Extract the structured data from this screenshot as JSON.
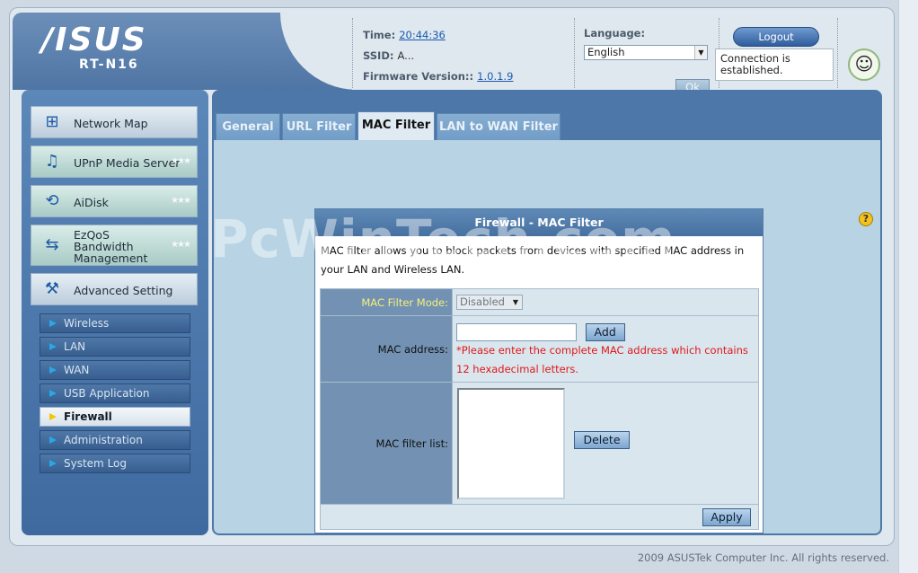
{
  "header": {
    "brand": "/ISUS",
    "model": "RT-N16",
    "time_label": "Time:",
    "time_value": "20:44:36",
    "ssid_label": "SSID:",
    "ssid_value": "A...",
    "firmware_label": "Firmware Version::",
    "firmware_value": "1.0.1.9",
    "language_label": "Language:",
    "language_value": "English",
    "ok_label": "Ok",
    "logout_label": "Logout",
    "connection_status": "Connection is established."
  },
  "sidebar": {
    "items": [
      {
        "label": "Network Map",
        "icon": "network-map-icon"
      },
      {
        "label": "UPnP Media Server",
        "icon": "media-server-icon"
      },
      {
        "label": "AiDisk",
        "icon": "aidisk-icon"
      },
      {
        "label": "EzQoS Bandwidth Management",
        "icon": "ezqos-icon"
      },
      {
        "label": "Advanced Setting",
        "icon": "wrench-icon"
      }
    ],
    "sub_items": [
      {
        "label": "Wireless"
      },
      {
        "label": "LAN"
      },
      {
        "label": "WAN"
      },
      {
        "label": "USB Application"
      },
      {
        "label": "Firewall",
        "active": true
      },
      {
        "label": "Administration"
      },
      {
        "label": "System Log"
      }
    ]
  },
  "tabs": [
    {
      "label": "General"
    },
    {
      "label": "URL Filter"
    },
    {
      "label": "MAC Filter",
      "active": true
    },
    {
      "label": "LAN to WAN Filter"
    }
  ],
  "form": {
    "title": "Firewall - MAC Filter",
    "description": "MAC filter allows you to block packets from devices with specified MAC address in your LAN and Wireless LAN.",
    "mode_label": "MAC Filter Mode:",
    "mode_value": "Disabled",
    "mac_label": "MAC address:",
    "mac_value": "",
    "add_label": "Add",
    "mac_warning": "*Please enter the complete MAC address which contains 12 hexadecimal letters.",
    "list_label": "MAC filter list:",
    "delete_label": "Delete",
    "apply_label": "Apply"
  },
  "footer": "2009 ASUSTek Computer Inc. All rights reserved.",
  "watermark": "PcWinTech.com",
  "colors": {
    "accent": "#4c77a8",
    "warning": "#e01818",
    "active_tab": "#dfeaf2"
  }
}
